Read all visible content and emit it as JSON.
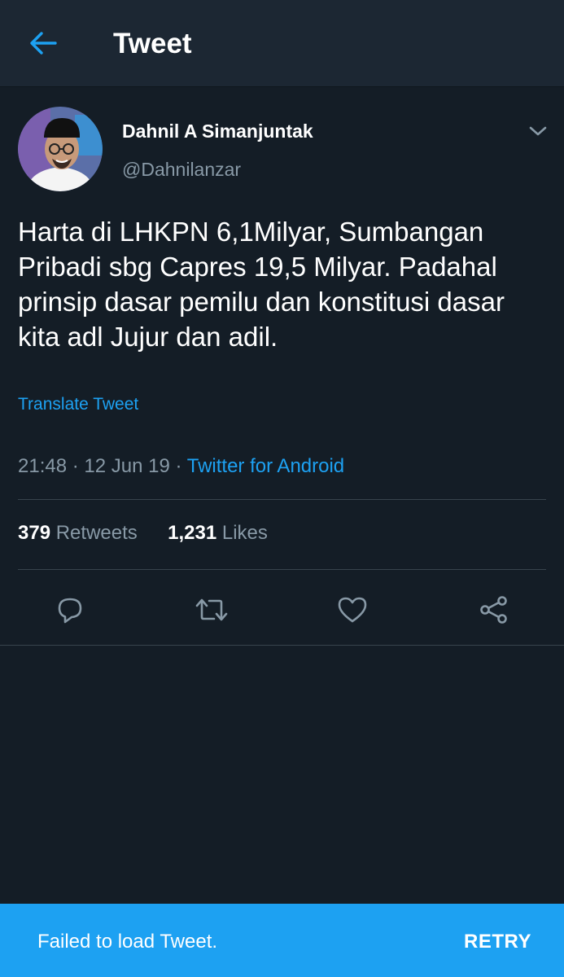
{
  "header": {
    "title": "Tweet"
  },
  "tweet": {
    "author_name": "Dahnil A Simanjuntak",
    "author_handle": "@Dahnilanzar",
    "text": "Harta di LHKPN 6,1Milyar, Sumbangan Pribadi sbg Capres 19,5 Milyar. Padahal prinsip dasar pemilu dan konstitusi dasar kita adl Jujur dan adil.",
    "translate_label": "Translate Tweet",
    "time": "21:48",
    "date": "12 Jun 19",
    "separator": "·",
    "source": "Twitter for Android",
    "retweet_count": "379",
    "retweet_label": "Retweets",
    "like_count": "1,231",
    "like_label": "Likes"
  },
  "icons": {
    "back": "arrow-left-icon",
    "menu": "chevron-down-icon",
    "reply": "reply-icon",
    "retweet": "retweet-icon",
    "like": "heart-icon",
    "share": "share-icon"
  },
  "snackbar": {
    "message": "Failed to load Tweet.",
    "action_label": "RETRY"
  },
  "colors": {
    "background": "#141d26",
    "header": "#1c2733",
    "accent": "#1da1f2",
    "secondary_text": "#8899a6",
    "divider": "#38444d"
  }
}
